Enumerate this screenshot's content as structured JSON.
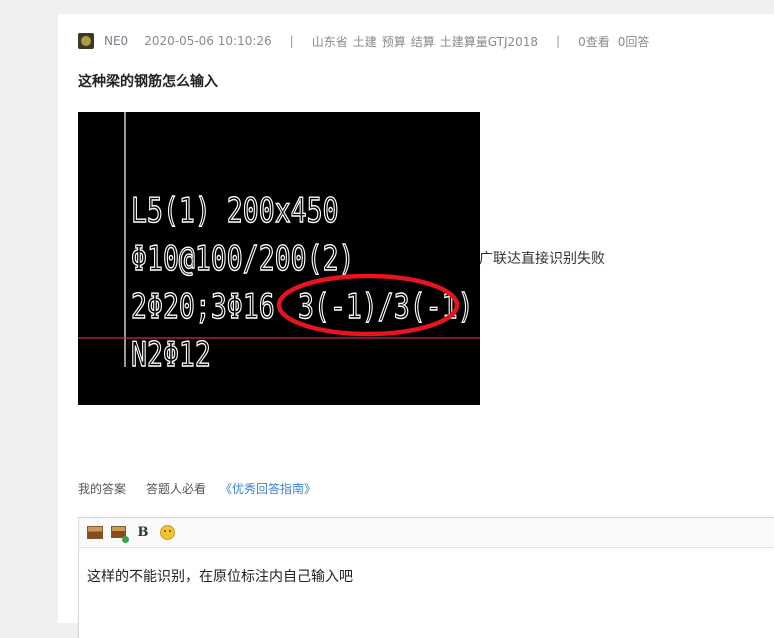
{
  "question": {
    "user": "NE0",
    "datetime": "2020-05-06 10:10:26",
    "separator": "|",
    "tags": [
      "山东省",
      "土建",
      "预算",
      "结算",
      "土建算量GTJ2018"
    ],
    "views": "0查看",
    "answers": "0回答",
    "title": "这种梁的钢筋怎么输入",
    "cad_lines": [
      "L5(1) 200x450",
      "Φ10@100/200(2)",
      "2Φ20;3Φ16",
      "3(-1)/3(-1)",
      "N2Φ12"
    ],
    "side_text": "广联达直接识别失败"
  },
  "answer_area": {
    "my_answer": "我的答案",
    "must_read": "答题人必看",
    "guide_link": "《优秀回答指南》",
    "toolbar": {
      "bold_label": "B",
      "icons": [
        "image-icon",
        "image-upload-icon",
        "bold-icon",
        "emoji-icon"
      ]
    },
    "content": "这样的不能识别，在原位标注内自己输入吧"
  },
  "colors": {
    "highlight_circle": "#e8141c",
    "cad_text": "#ffffff",
    "cad_bg": "#000000",
    "cad_magenta_line": "#c8236a",
    "link": "#3a7fd5"
  }
}
